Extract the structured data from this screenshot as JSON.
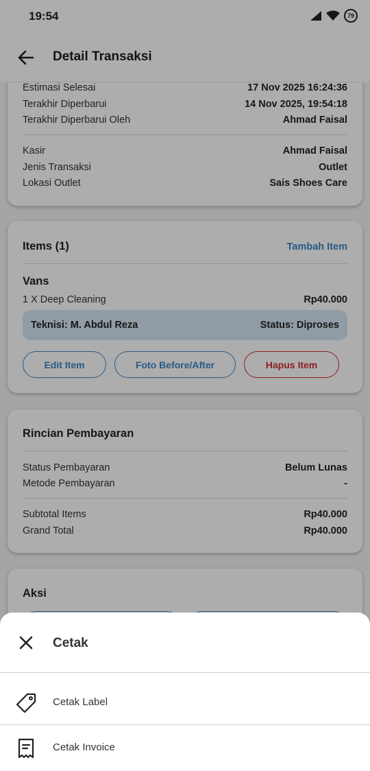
{
  "status_bar": {
    "time": "19:54",
    "battery": "79",
    "icons": [
      "signal-icon",
      "wifi-icon",
      "battery-icon"
    ]
  },
  "app_bar": {
    "title": "Detail Transaksi",
    "back_icon": "arrow-left-icon"
  },
  "info_card": {
    "group1": [
      {
        "label": "Estimasi Selesai",
        "value": "17 Nov 2025 16:24:36"
      },
      {
        "label": "Terakhir Diperbarui",
        "value": "14 Nov 2025, 19:54:18"
      },
      {
        "label": "Terakhir Diperbarui Oleh",
        "value": "Ahmad Faisal"
      }
    ],
    "group2": [
      {
        "label": "Kasir",
        "value": "Ahmad Faisal"
      },
      {
        "label": "Jenis Transaksi",
        "value": "Outlet"
      },
      {
        "label": "Lokasi Outlet",
        "value": "Sais Shoes Care"
      }
    ]
  },
  "items_card": {
    "title": "Items (1)",
    "add_link": "Tambah Item",
    "item": {
      "name": "Vans",
      "service": "1 X Deep Cleaning",
      "price": "Rp40.000",
      "technician": "Teknisi: M. Abdul Reza",
      "status": "Status: Diproses"
    },
    "buttons": {
      "edit": "Edit Item",
      "photo": "Foto Before/After",
      "delete": "Hapus Item"
    }
  },
  "payment_card": {
    "title": "Rincian Pembayaran",
    "status_rows": [
      {
        "label": "Status Pembayaran",
        "value": "Belum Lunas"
      },
      {
        "label": "Metode Pembayaran",
        "value": "-"
      }
    ],
    "total_rows": [
      {
        "label": "Subtotal Items",
        "value": "Rp40.000"
      },
      {
        "label": "Grand Total",
        "value": "Rp40.000"
      }
    ]
  },
  "action_card": {
    "title": "Aksi"
  },
  "sheet": {
    "title": "Cetak",
    "close_icon": "close-icon",
    "options": [
      {
        "label": "Cetak Label",
        "icon": "tag-icon"
      },
      {
        "label": "Cetak Invoice",
        "icon": "receipt-icon"
      }
    ]
  },
  "colors": {
    "accent": "#3a87c8",
    "danger": "#d32f2f",
    "tech_bg": "#d4e6f4",
    "scrim": "rgba(0,0,0,0.32)"
  }
}
